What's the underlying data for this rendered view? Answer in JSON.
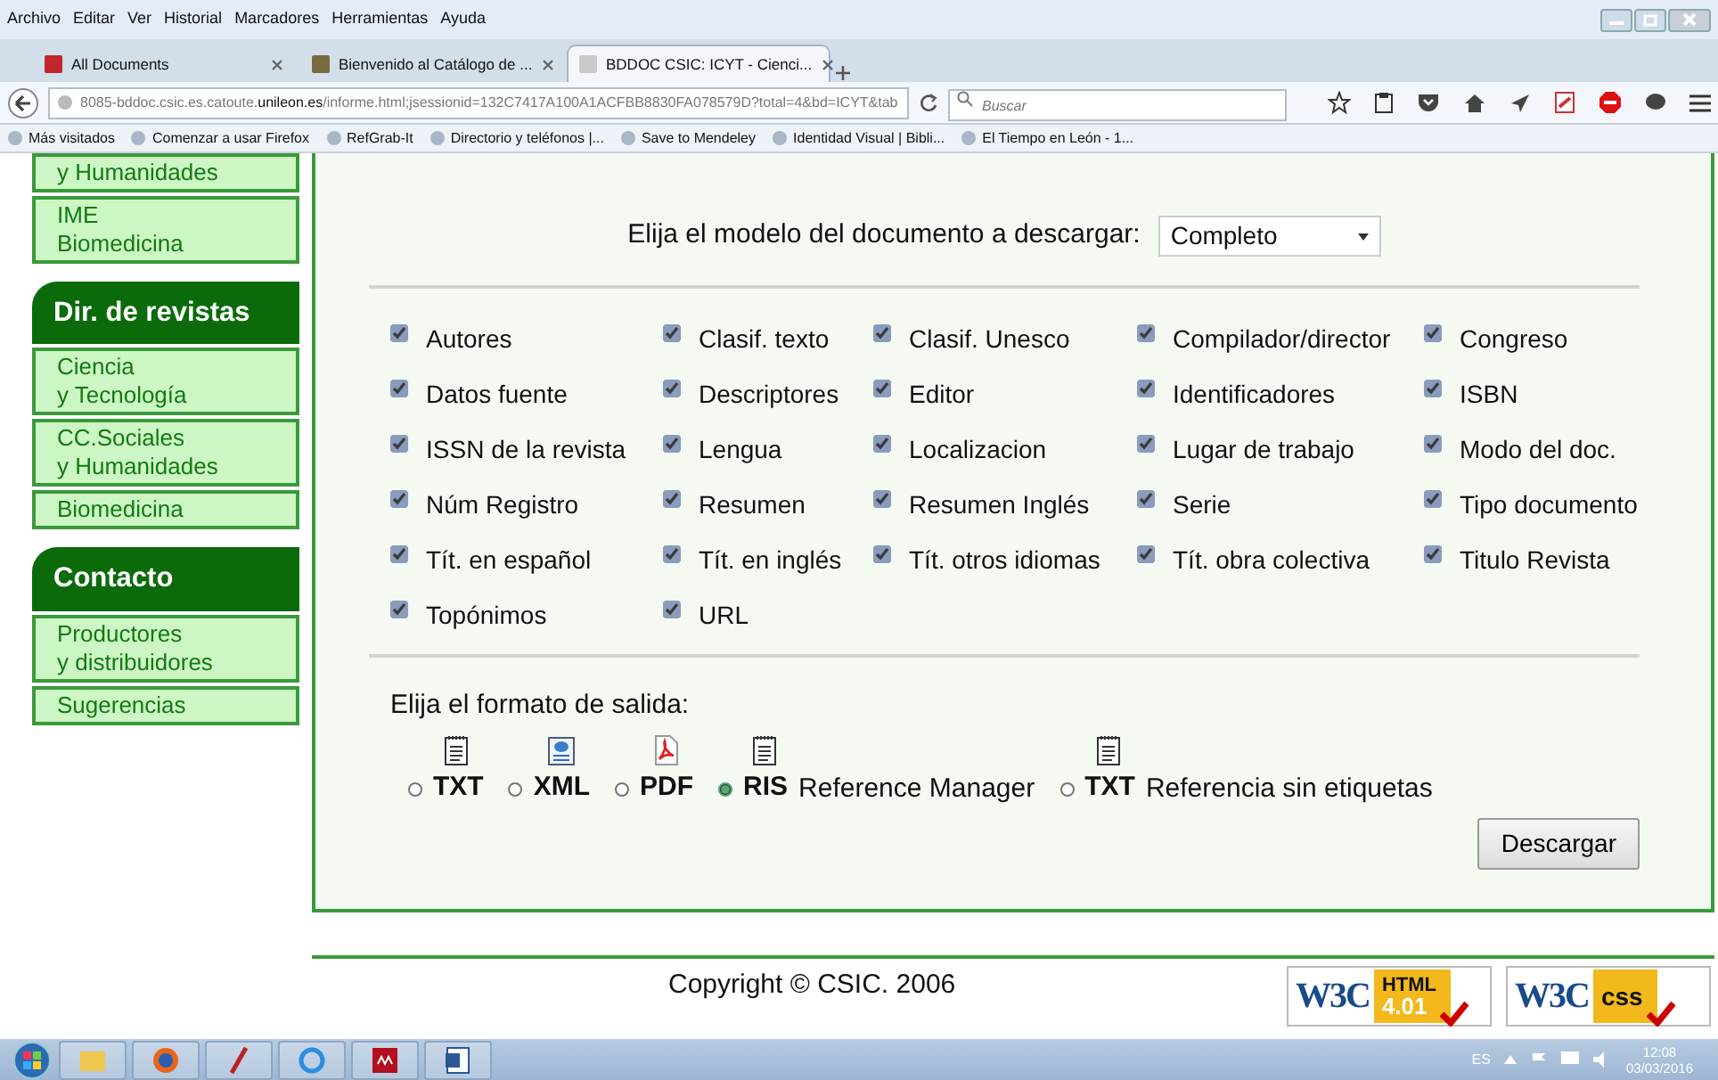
{
  "browser": {
    "menu": [
      "Archivo",
      "Editar",
      "Ver",
      "Historial",
      "Marcadores",
      "Herramientas",
      "Ayuda"
    ],
    "tabs": [
      {
        "title": "All Documents",
        "selected": false
      },
      {
        "title": "Bienvenido al Catálogo de ...",
        "selected": false
      },
      {
        "title": "BDDOC CSIC: ICYT - Cienci...",
        "selected": true
      }
    ],
    "url": "8085-bddoc.csic.es.catoute.**unileon.es**/informe.html;jsessionid=132C7417A100A1ACFBB8830FA078579D?total=4&bd=ICYT&tab",
    "search": {
      "placeholder": "Buscar"
    },
    "bookmarks": [
      "Más visitados",
      "Comenzar a usar Firefox",
      "RefGrab-It",
      "Directorio y teléfonos |...",
      "Save to Mendeley",
      "Identidad Visual | Bibli...",
      "El Tiempo en León - 1..."
    ]
  },
  "sidebar": [
    {
      "items": [
        {
          "lines": [
            "y Humanidades"
          ]
        },
        {
          "lines": [
            "IME",
            "Biomedicina"
          ]
        }
      ]
    },
    {
      "heading": "Dir. de revistas",
      "items": [
        {
          "lines": [
            "Ciencia",
            "y Tecnología"
          ]
        },
        {
          "lines": [
            "CC.Sociales",
            "y Humanidades"
          ]
        },
        {
          "lines": [
            "Biomedicina"
          ]
        }
      ]
    },
    {
      "heading": "Contacto",
      "items": [
        {
          "lines": [
            "Productores",
            "y distribuidores"
          ]
        },
        {
          "lines": [
            "Sugerencias"
          ]
        }
      ]
    }
  ],
  "model_select": {
    "label": "Elija el modelo del documento a descargar:",
    "value": "Completo"
  },
  "fields": [
    {
      "label": "Autores",
      "checked": true
    },
    {
      "label": "Clasif. texto",
      "checked": true
    },
    {
      "label": "Clasif. Unesco",
      "checked": true
    },
    {
      "label": "Compilador/director",
      "checked": true
    },
    {
      "label": "Congreso",
      "checked": true
    },
    {
      "label": "Datos fuente",
      "checked": true
    },
    {
      "label": "Descriptores",
      "checked": true
    },
    {
      "label": "Editor",
      "checked": true
    },
    {
      "label": "Identificadores",
      "checked": true
    },
    {
      "label": "ISBN",
      "checked": true
    },
    {
      "label": "ISSN de la revista",
      "checked": true
    },
    {
      "label": "Lengua",
      "checked": true
    },
    {
      "label": "Localizacion",
      "checked": true
    },
    {
      "label": "Lugar de trabajo",
      "checked": true
    },
    {
      "label": "Modo del doc.",
      "checked": true
    },
    {
      "label": "Núm Registro",
      "checked": true
    },
    {
      "label": "Resumen",
      "checked": true
    },
    {
      "label": "Resumen Inglés",
      "checked": true
    },
    {
      "label": "Serie",
      "checked": true
    },
    {
      "label": "Tipo documento",
      "checked": true
    },
    {
      "label": "Tít. en español",
      "checked": true
    },
    {
      "label": "Tít. en inglés",
      "checked": true
    },
    {
      "label": "Tít. otros idiomas",
      "checked": true
    },
    {
      "label": "Tít. obra colectiva",
      "checked": true
    },
    {
      "label": "Titulo Revista",
      "checked": true
    },
    {
      "label": "Topónimos",
      "checked": true
    },
    {
      "label": "URL",
      "checked": true
    }
  ],
  "output": {
    "label": "Elija el formato de salida:",
    "formats": [
      {
        "kind": "text",
        "label": "TXT",
        "selected": false
      },
      {
        "kind": "xml",
        "label": "XML",
        "selected": false
      },
      {
        "kind": "pdf",
        "label": "PDF",
        "selected": false
      },
      {
        "kind": "text",
        "label": "RIS",
        "description": "Reference Manager",
        "selected": true
      },
      {
        "kind": "text",
        "label": "TXT",
        "description": "Referencia sin etiquetas",
        "selected": false
      }
    ]
  },
  "download_button": "Descargar",
  "footer": {
    "copyright": "Copyright © CSIC. 2006",
    "badges": [
      {
        "kind": "html",
        "logo": "W3C",
        "name": "HTML",
        "version": "4.01"
      },
      {
        "kind": "css",
        "logo": "W3C",
        "name": "css"
      }
    ]
  },
  "taskbar": {
    "language": "ES",
    "time": "12:08",
    "date": "03/03/2016"
  }
}
